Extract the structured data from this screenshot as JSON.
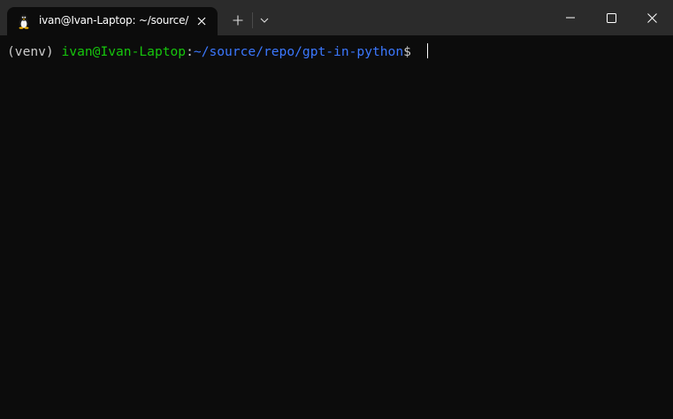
{
  "window": {
    "tab_title": "ivan@Ivan-Laptop: ~/source/",
    "tab_icon": "linux-tux-icon",
    "new_tab_icon": "plus-icon",
    "dropdown_icon": "chevron-down-icon",
    "controls": [
      "minimize-icon",
      "maximize-icon",
      "close-icon"
    ]
  },
  "terminal": {
    "venv": "(venv) ",
    "user_host": "ivan@Ivan-Laptop",
    "colon": ":",
    "path": "~/source/repo/gpt-in-python",
    "prompt": "$ "
  },
  "colors": {
    "background": "#0c0c0c",
    "titlebar": "#2b2b2b",
    "text": "#cccccc",
    "user": "#16c60c",
    "path": "#3b78ff"
  }
}
